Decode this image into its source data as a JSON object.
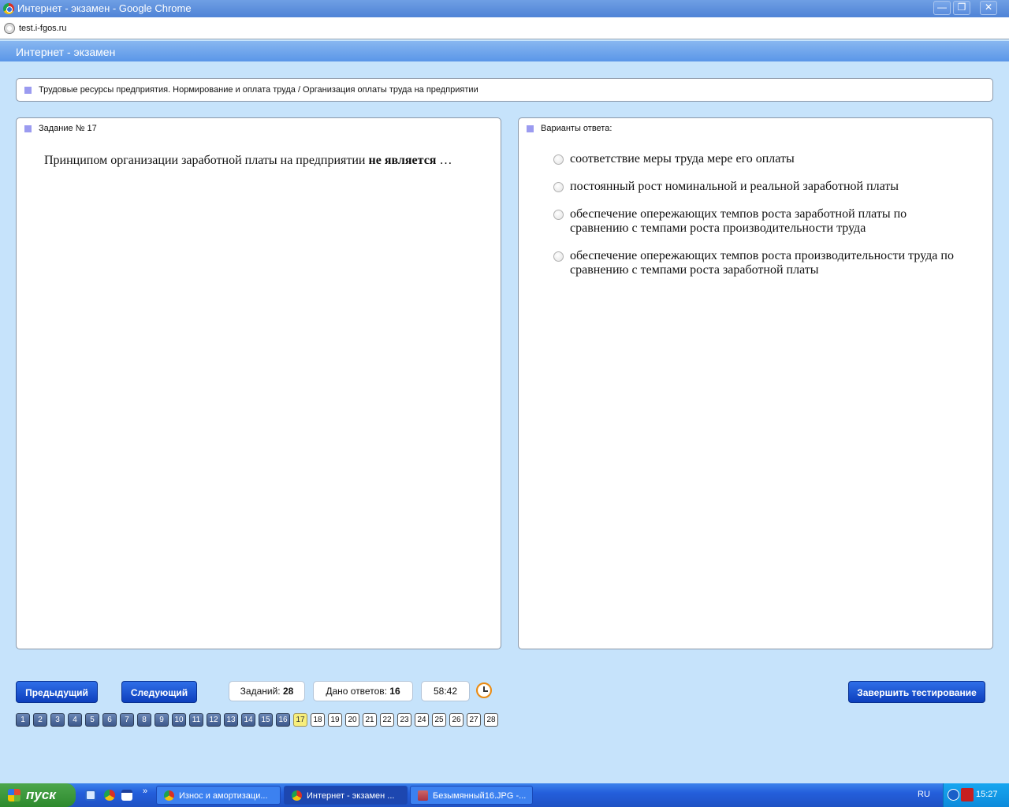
{
  "window": {
    "title": "Интернет - экзамен - Google Chrome",
    "minimize": "—",
    "maximize": "❐",
    "close": "✕"
  },
  "address": {
    "url": "test.i-fgos.ru"
  },
  "app": {
    "title": "Интернет - экзамен"
  },
  "topic": {
    "text": "Трудовые ресурсы предприятия. Нормирование и оплата труда / Организация оплаты труда на предприятии"
  },
  "task": {
    "header": "Задание № 17",
    "question_normal": "Принципом организации заработной платы на предприятии ",
    "question_bold": "не является",
    "question_tail": " …"
  },
  "answers": {
    "header": "Варианты ответа:",
    "options": [
      "соответствие меры труда мере его оплаты",
      "постоянный рост номинальной и реальной заработной платы",
      "обеспечение опережающих темпов роста заработной платы по сравнению с темпами роста производительности труда",
      "обеспечение опережающих темпов роста производительности труда по сравнению с темпами роста заработной платы"
    ]
  },
  "controls": {
    "prev": "Предыдущий",
    "next": "Следующий",
    "tasks_label": "Заданий:",
    "tasks_value": "28",
    "answered_label": "Дано ответов:",
    "answered_value": "16",
    "timer": "58:42",
    "finish": "Завершить тестирование"
  },
  "pager": {
    "pages": [
      "1",
      "2",
      "3",
      "4",
      "5",
      "6",
      "7",
      "8",
      "9",
      "10",
      "11",
      "12",
      "13",
      "14",
      "15",
      "16",
      "17",
      "18",
      "19",
      "20",
      "21",
      "22",
      "23",
      "24",
      "25",
      "26",
      "27",
      "28"
    ],
    "current": "17",
    "answered_count": 16
  },
  "taskbar": {
    "start": "пуск",
    "items": [
      "Износ и амортизаци...",
      "Интернет - экзамен ...",
      "Безымянный16.JPG -..."
    ],
    "active_index": 1,
    "lang": "RU",
    "time": "15:27"
  }
}
